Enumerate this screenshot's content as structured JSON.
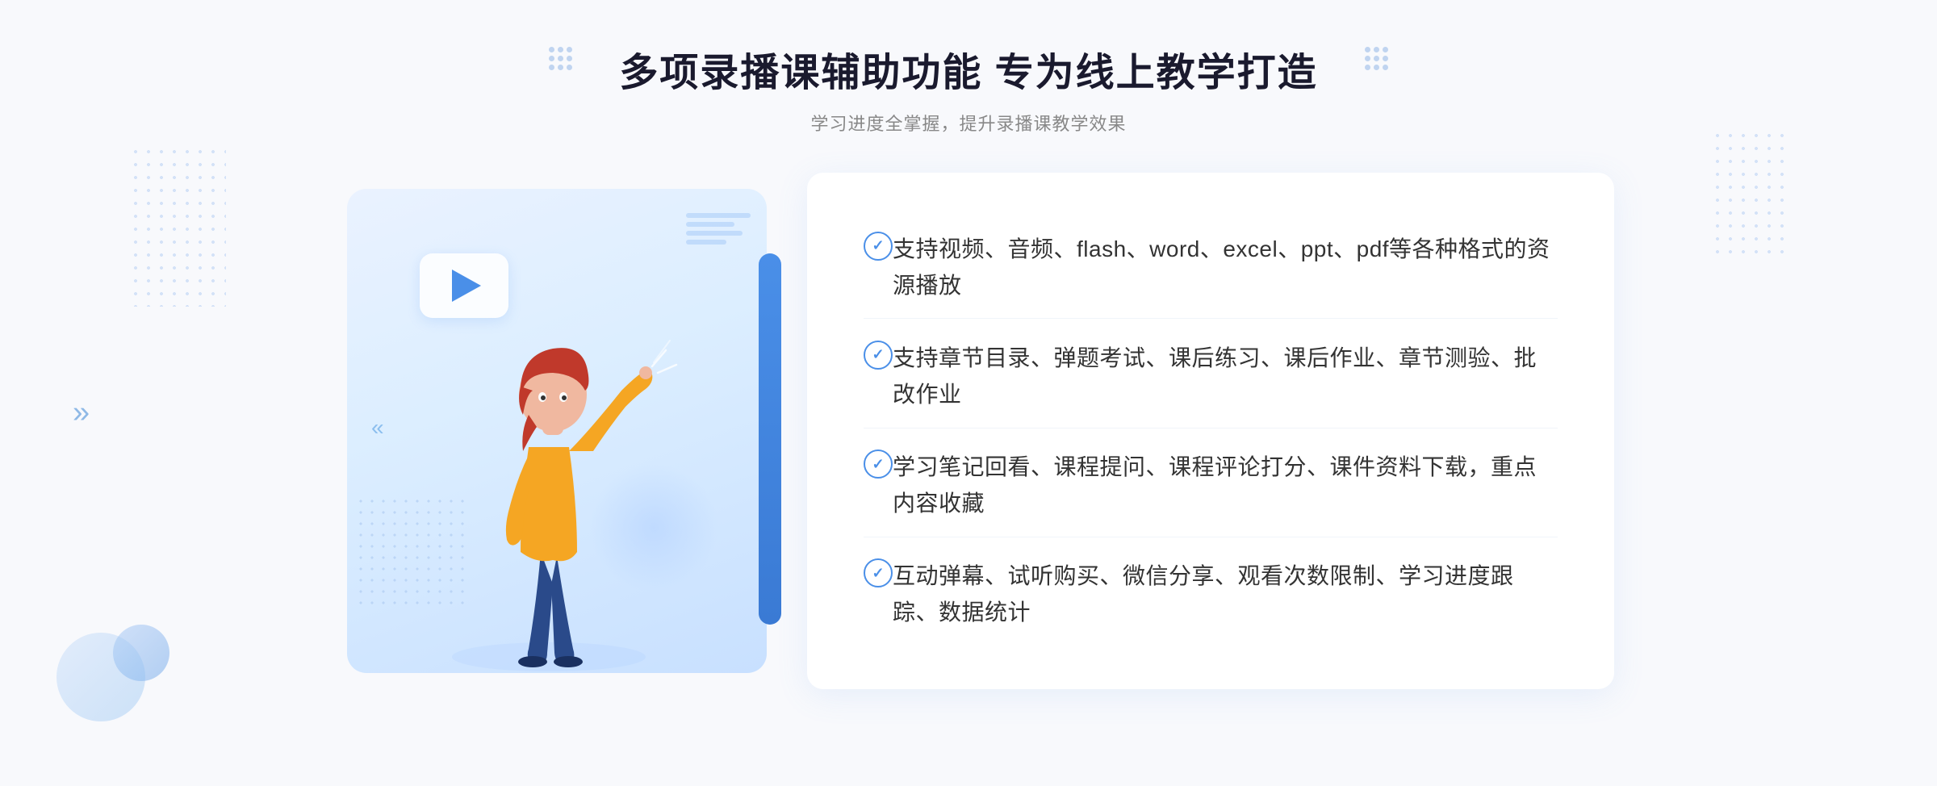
{
  "header": {
    "main_title": "多项录播课辅助功能 专为线上教学打造",
    "sub_title": "学习进度全掌握，提升录播课教学效果"
  },
  "features": [
    {
      "id": "feature-1",
      "text": "支持视频、音频、flash、word、excel、ppt、pdf等各种格式的资源播放"
    },
    {
      "id": "feature-2",
      "text": "支持章节目录、弹题考试、课后练习、课后作业、章节测验、批改作业"
    },
    {
      "id": "feature-3",
      "text": "学习笔记回看、课程提问、课程评论打分、课件资料下载，重点内容收藏"
    },
    {
      "id": "feature-4",
      "text": "互动弹幕、试听购买、微信分享、观看次数限制、学习进度跟踪、数据统计"
    }
  ],
  "decoration": {
    "arrow_symbol": "»",
    "play_icon": "▶"
  }
}
